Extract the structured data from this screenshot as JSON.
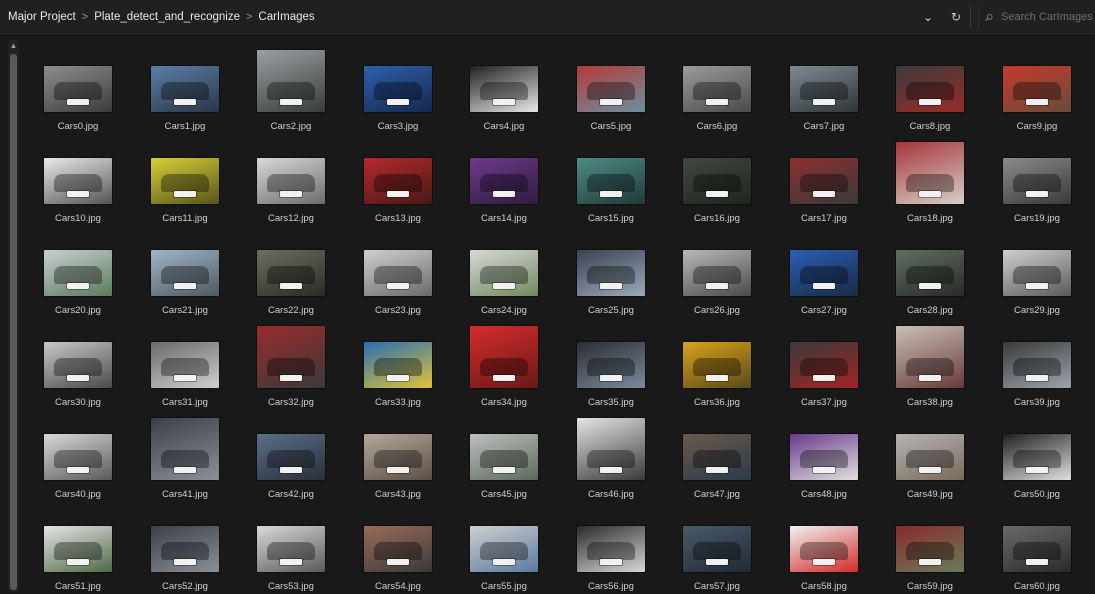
{
  "breadcrumb": [
    "Major Project",
    "Plate_detect_and_recognize",
    "CarImages"
  ],
  "search": {
    "placeholder": "Search CarImages"
  },
  "files": [
    {
      "name": "Cars0.jpg",
      "icon": "image-thumbnail",
      "colors": [
        "#8d8d8d",
        "#3c3c3c"
      ]
    },
    {
      "name": "Cars1.jpg",
      "icon": "image-thumbnail",
      "colors": [
        "#5a7fa8",
        "#2b3646"
      ]
    },
    {
      "name": "Cars2.jpg",
      "icon": "image-thumbnail",
      "colors": [
        "#9aa0a2",
        "#3a3c3c"
      ],
      "tall": true
    },
    {
      "name": "Cars3.jpg",
      "icon": "image-thumbnail",
      "colors": [
        "#2c5fb0",
        "#17294a"
      ]
    },
    {
      "name": "Cars4.jpg",
      "icon": "image-thumbnail",
      "colors": [
        "#202020",
        "#e8e8e8"
      ]
    },
    {
      "name": "Cars5.jpg",
      "icon": "image-thumbnail",
      "colors": [
        "#b33a3a",
        "#6d8fa0"
      ]
    },
    {
      "name": "Cars6.jpg",
      "icon": "image-thumbnail",
      "colors": [
        "#9b9b9b",
        "#4a4a4a"
      ]
    },
    {
      "name": "Cars7.jpg",
      "icon": "image-thumbnail",
      "colors": [
        "#7f8a8f",
        "#2e3538"
      ]
    },
    {
      "name": "Cars8.jpg",
      "icon": "image-thumbnail",
      "colors": [
        "#3b3b3b",
        "#9a2b2b"
      ]
    },
    {
      "name": "Cars9.jpg",
      "icon": "image-thumbnail",
      "colors": [
        "#c43a2c",
        "#6a4b3a"
      ]
    },
    {
      "name": "Cars10.jpg",
      "icon": "image-thumbnail",
      "colors": [
        "#e9e9e9",
        "#555555"
      ]
    },
    {
      "name": "Cars11.jpg",
      "icon": "image-thumbnail",
      "colors": [
        "#d7cf3a",
        "#57551a"
      ]
    },
    {
      "name": "Cars12.jpg",
      "icon": "image-thumbnail",
      "colors": [
        "#d8d8d8",
        "#6d6d6d"
      ]
    },
    {
      "name": "Cars13.jpg",
      "icon": "image-thumbnail",
      "colors": [
        "#b52a2a",
        "#4a1818"
      ]
    },
    {
      "name": "Cars14.jpg",
      "icon": "image-thumbnail",
      "colors": [
        "#6e3a8c",
        "#2f1c3d"
      ]
    },
    {
      "name": "Cars15.jpg",
      "icon": "image-thumbnail",
      "colors": [
        "#4d8c86",
        "#223a38"
      ]
    },
    {
      "name": "Cars16.jpg",
      "icon": "image-thumbnail",
      "colors": [
        "#3f4a3f",
        "#1f241f"
      ]
    },
    {
      "name": "Cars17.jpg",
      "icon": "image-thumbnail",
      "colors": [
        "#8d2f2f",
        "#3a3a3a"
      ]
    },
    {
      "name": "Cars18.jpg",
      "icon": "image-thumbnail",
      "colors": [
        "#a8343a",
        "#d6d0c8"
      ],
      "tall": true
    },
    {
      "name": "Cars19.jpg",
      "icon": "image-thumbnail",
      "colors": [
        "#8a8a8a",
        "#3a3a3a"
      ]
    },
    {
      "name": "Cars20.jpg",
      "icon": "image-thumbnail",
      "colors": [
        "#c8cfd3",
        "#5b7a5b"
      ]
    },
    {
      "name": "Cars21.jpg",
      "icon": "image-thumbnail",
      "colors": [
        "#9fb5c6",
        "#4f5a62"
      ]
    },
    {
      "name": "Cars22.jpg",
      "icon": "image-thumbnail",
      "colors": [
        "#6a6f5f",
        "#2a2c24"
      ]
    },
    {
      "name": "Cars23.jpg",
      "icon": "image-thumbnail",
      "colors": [
        "#cfcfcf",
        "#6a6a6a"
      ]
    },
    {
      "name": "Cars24.jpg",
      "icon": "image-thumbnail",
      "colors": [
        "#d8d8d8",
        "#6f8a5c"
      ]
    },
    {
      "name": "Cars25.jpg",
      "icon": "image-thumbnail",
      "colors": [
        "#3a4250",
        "#9aaabb"
      ]
    },
    {
      "name": "Cars26.jpg",
      "icon": "image-thumbnail",
      "colors": [
        "#b9b9b9",
        "#4a4a4a"
      ]
    },
    {
      "name": "Cars27.jpg",
      "icon": "image-thumbnail",
      "colors": [
        "#2a5fb5",
        "#1a2a44"
      ]
    },
    {
      "name": "Cars28.jpg",
      "icon": "image-thumbnail",
      "colors": [
        "#5f6f5f",
        "#2a2a2a"
      ]
    },
    {
      "name": "Cars29.jpg",
      "icon": "image-thumbnail",
      "colors": [
        "#cfcfcf",
        "#5a5a5a"
      ]
    },
    {
      "name": "Cars30.jpg",
      "icon": "image-thumbnail",
      "colors": [
        "#c9c9c9",
        "#4a4a4a"
      ]
    },
    {
      "name": "Cars31.jpg",
      "icon": "image-thumbnail",
      "colors": [
        "#6a6a6a",
        "#cfcfcf"
      ]
    },
    {
      "name": "Cars32.jpg",
      "icon": "image-thumbnail",
      "colors": [
        "#9a2b2b",
        "#3a3a3a"
      ],
      "tall": true
    },
    {
      "name": "Cars33.jpg",
      "icon": "image-thumbnail",
      "colors": [
        "#2a6fb0",
        "#e0c23a"
      ]
    },
    {
      "name": "Cars34.jpg",
      "icon": "image-thumbnail",
      "colors": [
        "#d62b2b",
        "#6a1a1a"
      ],
      "tall": true
    },
    {
      "name": "Cars35.jpg",
      "icon": "image-thumbnail",
      "colors": [
        "#2a2e36",
        "#7a8a9a"
      ]
    },
    {
      "name": "Cars36.jpg",
      "icon": "image-thumbnail",
      "colors": [
        "#d9a21a",
        "#5a4a1a"
      ]
    },
    {
      "name": "Cars37.jpg",
      "icon": "image-thumbnail",
      "colors": [
        "#3a3a3a",
        "#a32424"
      ]
    },
    {
      "name": "Cars38.jpg",
      "icon": "image-thumbnail",
      "colors": [
        "#c9c0b5",
        "#6a3a3a"
      ],
      "tall": true
    },
    {
      "name": "Cars39.jpg",
      "icon": "image-thumbnail",
      "colors": [
        "#3a3a3a",
        "#9aa5ad"
      ]
    },
    {
      "name": "Cars40.jpg",
      "icon": "image-thumbnail",
      "colors": [
        "#d9d9d9",
        "#5a5a5a"
      ]
    },
    {
      "name": "Cars41.jpg",
      "icon": "image-thumbnail",
      "colors": [
        "#3a3f48",
        "#8a8f98"
      ],
      "tall": true
    },
    {
      "name": "Cars42.jpg",
      "icon": "image-thumbnail",
      "colors": [
        "#5a6f8a",
        "#2a2f38"
      ]
    },
    {
      "name": "Cars43.jpg",
      "icon": "image-thumbnail",
      "colors": [
        "#b5a89a",
        "#5a4f45"
      ]
    },
    {
      "name": "Cars45.jpg",
      "icon": "image-thumbnail",
      "colors": [
        "#bfbfbf",
        "#5a6a5a"
      ]
    },
    {
      "name": "Cars46.jpg",
      "icon": "image-thumbnail",
      "colors": [
        "#e5e5e5",
        "#3a3a3a"
      ],
      "tall": true
    },
    {
      "name": "Cars47.jpg",
      "icon": "image-thumbnail",
      "colors": [
        "#6a5a4a",
        "#2a3a4a"
      ]
    },
    {
      "name": "Cars48.jpg",
      "icon": "image-thumbnail",
      "colors": [
        "#6a3a8c",
        "#e0e0e0"
      ]
    },
    {
      "name": "Cars49.jpg",
      "icon": "image-thumbnail",
      "colors": [
        "#b5b5b5",
        "#7a6a5a"
      ]
    },
    {
      "name": "Cars50.jpg",
      "icon": "image-thumbnail",
      "colors": [
        "#1f1f1f",
        "#e0e0e0"
      ]
    },
    {
      "name": "Cars51.jpg",
      "icon": "image-thumbnail",
      "colors": [
        "#e5e5e5",
        "#4f6a45"
      ]
    },
    {
      "name": "Cars52.jpg",
      "icon": "image-thumbnail",
      "colors": [
        "#3a3f48",
        "#8a9098"
      ]
    },
    {
      "name": "Cars53.jpg",
      "icon": "image-thumbnail",
      "colors": [
        "#d9d9d9",
        "#5a5a5a"
      ]
    },
    {
      "name": "Cars54.jpg",
      "icon": "image-thumbnail",
      "colors": [
        "#9a6a5a",
        "#3a3a3a"
      ]
    },
    {
      "name": "Cars55.jpg",
      "icon": "image-thumbnail",
      "colors": [
        "#cfcfcf",
        "#5a7aa0"
      ]
    },
    {
      "name": "Cars56.jpg",
      "icon": "image-thumbnail",
      "colors": [
        "#2a2a2a",
        "#d9d9d9"
      ]
    },
    {
      "name": "Cars57.jpg",
      "icon": "image-thumbnail",
      "colors": [
        "#4a5a6a",
        "#1f2a35"
      ]
    },
    {
      "name": "Cars58.jpg",
      "icon": "image-thumbnail",
      "colors": [
        "#f2f2f2",
        "#d22b2b"
      ]
    },
    {
      "name": "Cars59.jpg",
      "icon": "image-thumbnail",
      "colors": [
        "#8a2b2b",
        "#6a7a5a"
      ]
    },
    {
      "name": "Cars60.jpg",
      "icon": "image-thumbnail",
      "colors": [
        "#6a6a6a",
        "#2a2a2a"
      ]
    }
  ]
}
